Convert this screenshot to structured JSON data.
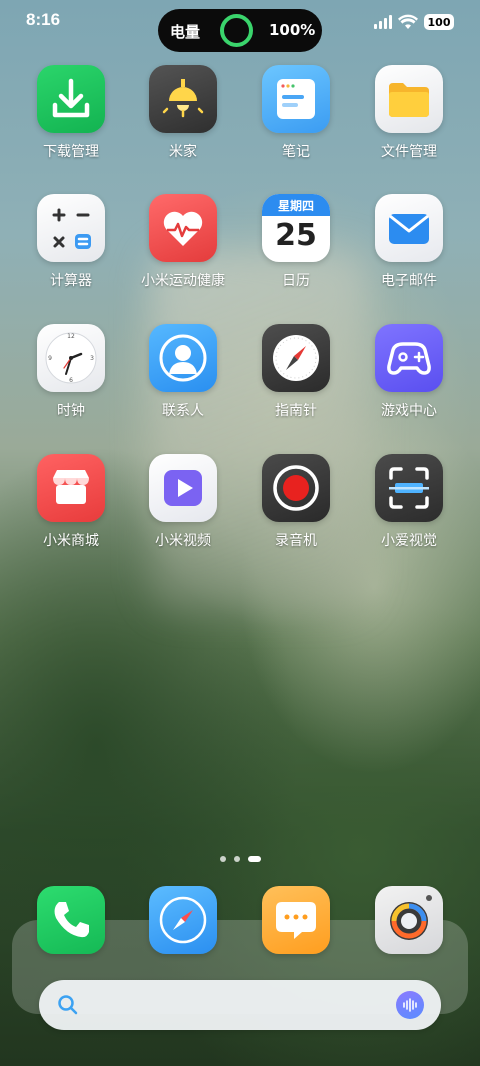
{
  "status_bar": {
    "time": "8:16",
    "island_label": "电量",
    "island_value": "100%",
    "battery_level": "100"
  },
  "apps": [
    {
      "label": "下载管理",
      "icon": "download-icon"
    },
    {
      "label": "米家",
      "icon": "lamp-icon"
    },
    {
      "label": "笔记",
      "icon": "notes-icon"
    },
    {
      "label": "文件管理",
      "icon": "folder-icon"
    },
    {
      "label": "计算器",
      "icon": "calculator-icon"
    },
    {
      "label": "小米运动健康",
      "icon": "heart-icon"
    },
    {
      "label": "日历",
      "icon": "calendar-icon",
      "weekday": "星期四",
      "day": "25"
    },
    {
      "label": "电子邮件",
      "icon": "mail-icon"
    },
    {
      "label": "时钟",
      "icon": "clock-icon"
    },
    {
      "label": "联系人",
      "icon": "contact-icon"
    },
    {
      "label": "指南针",
      "icon": "compass-icon"
    },
    {
      "label": "游戏中心",
      "icon": "gamepad-icon"
    },
    {
      "label": "小米商城",
      "icon": "store-icon"
    },
    {
      "label": "小米视频",
      "icon": "play-icon"
    },
    {
      "label": "录音机",
      "icon": "record-icon"
    },
    {
      "label": "小爱视觉",
      "icon": "scan-icon"
    }
  ],
  "page_indicator": {
    "count": 3,
    "active": 3
  },
  "dock": [
    "phone-icon",
    "browser-icon",
    "messages-icon",
    "camera-icon"
  ],
  "colors": {
    "download": "#1fc45d",
    "health": "#f04e4e",
    "contacts": "#2f9ff0",
    "games": "#6a5cf0",
    "store": "#f04c4c",
    "record": "#e8221f",
    "island_ring": "#3ad46c"
  }
}
